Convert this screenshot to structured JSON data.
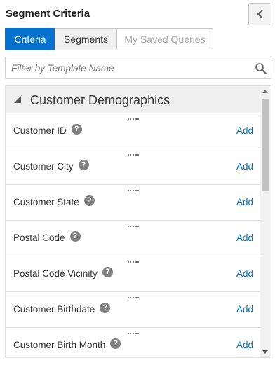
{
  "panel": {
    "title": "Segment Criteria",
    "collapse_icon": "chevron-left-icon"
  },
  "tabs": [
    {
      "label": "Criteria",
      "state": "active"
    },
    {
      "label": "Segments",
      "state": "normal"
    },
    {
      "label": "My Saved Queries",
      "state": "disabled"
    }
  ],
  "search": {
    "placeholder": "Filter by Template Name",
    "value": "",
    "icon": "search-icon"
  },
  "group": {
    "title": "Customer Demographics",
    "expanded": true,
    "toggle_icon": "triangle-expanded-icon"
  },
  "items": [
    {
      "label": "Customer ID",
      "action": "Add"
    },
    {
      "label": "Customer City",
      "action": "Add"
    },
    {
      "label": "Customer State",
      "action": "Add"
    },
    {
      "label": "Postal Code",
      "action": "Add"
    },
    {
      "label": "Postal Code Vicinity",
      "action": "Add"
    },
    {
      "label": "Customer Birthdate",
      "action": "Add"
    },
    {
      "label": "Customer Birth Month",
      "action": "Add"
    }
  ],
  "help_glyph": "?",
  "colors": {
    "accent": "#0572ce",
    "link": "#0572ce",
    "help_icon": "#7f7f7f",
    "group_header_bg": "#f0f0f0"
  }
}
